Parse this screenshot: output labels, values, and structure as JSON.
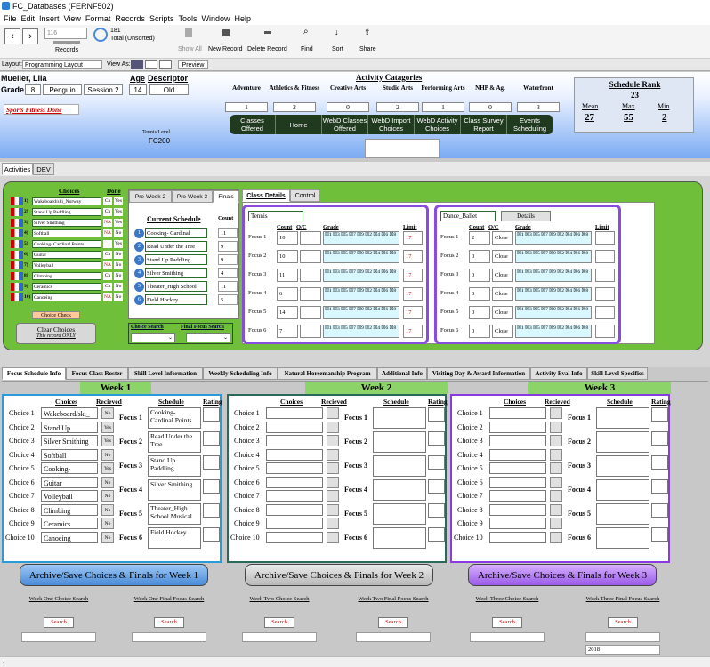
{
  "window": {
    "title": "FC_Databases (FERNF502)"
  },
  "menu": [
    "File",
    "Edit",
    "Insert",
    "View",
    "Format",
    "Records",
    "Scripts",
    "Tools",
    "Window",
    "Help"
  ],
  "toolbar": {
    "record_value": "116",
    "total": "181",
    "total_label": "Total (Unsorted)",
    "records_label": "Records",
    "show_all": "Show All",
    "new_record": "New Record",
    "delete_record": "Delete Record",
    "find": "Find",
    "sort": "Sort",
    "share": "Share"
  },
  "layoutbar": {
    "layout_label": "Layout:",
    "layout_value": "Programming Layout",
    "view_as": "View As:",
    "preview": "Preview"
  },
  "student": {
    "name": "Mueller, Lila",
    "grade_label": "Grade",
    "grade": "8",
    "group": "Penguin",
    "session": "Session 2",
    "age_label": "Age",
    "age": "14",
    "descriptor_label": "Descriptor",
    "descriptor": "Old",
    "alert": "Sports Fitness Done",
    "tennis_level_label": "Tennis Level",
    "tennis_level": "FC200"
  },
  "categories": {
    "title": "Activity Catagories",
    "items": [
      {
        "label": "Adventure",
        "value": "1"
      },
      {
        "label": "Athletics & Fitness",
        "value": "2"
      },
      {
        "label": "Creative Arts",
        "value": "0"
      },
      {
        "label": "Studio Arts",
        "value": "2"
      },
      {
        "label": "Performing Arts",
        "value": "1"
      },
      {
        "label": "NHP & Ag.",
        "value": "0"
      },
      {
        "label": "Waterfront",
        "value": "3"
      }
    ]
  },
  "nav_buttons": [
    "Classes Offered",
    "Home",
    "WebD Classes Offered",
    "WebD Import Choices",
    "WebD Activity Choices",
    "Class Survey Report",
    "Events Scheduling"
  ],
  "schedule_rank": {
    "title": "Schedule Rank",
    "value": "23",
    "mean_label": "Mean",
    "mean": "27",
    "max_label": "Max",
    "max": "55",
    "min_label": "Min",
    "min": "2"
  },
  "main_tabs": [
    "Activities",
    "DEV"
  ],
  "choices_panel": {
    "choices_header": "Choices",
    "done_header": "Done",
    "items": [
      {
        "n": "1)",
        "name": "Wakeboard/ski_Norway",
        "a": "Ch",
        "b": "Yes"
      },
      {
        "n": "2)",
        "name": "Stand Up Paddling",
        "a": "Ch",
        "b": "Yes"
      },
      {
        "n": "3)",
        "name": "Silver Smithing",
        "a": "NA",
        "b": "Yes"
      },
      {
        "n": "4)",
        "name": "Softball",
        "a": "NA",
        "b": "No"
      },
      {
        "n": "5)",
        "name": "Cooking- Cardinal Points",
        "a": "",
        "b": "Yes"
      },
      {
        "n": "6)",
        "name": "Guitar",
        "a": "Ch",
        "b": "No"
      },
      {
        "n": "7)",
        "name": "Volleyball",
        "a": "NA",
        "b": "No"
      },
      {
        "n": "8)",
        "name": "Climbing",
        "a": "Ch",
        "b": "No"
      },
      {
        "n": "9)",
        "name": "Ceramics",
        "a": "Ch",
        "b": "No"
      },
      {
        "n": "10)",
        "name": "Canoeing",
        "a": "NA",
        "b": "No"
      }
    ],
    "choice_check": "Choice Check",
    "clear_choices": "Clear Choices",
    "this_record_only": "This record ONLY"
  },
  "week_tabs": [
    "Pre-Week 2",
    "Pre-Week 3",
    "Finals"
  ],
  "current_schedule": {
    "title": "Current Schedule",
    "count_label": "Count",
    "items": [
      {
        "n": "1",
        "name": "Cooking- Cardinal",
        "count": "11"
      },
      {
        "n": "2",
        "name": "Read Under the Tree",
        "count": "9"
      },
      {
        "n": "3",
        "name": "Stand Up Paddling",
        "count": "9"
      },
      {
        "n": "4",
        "name": "Silver Smithing",
        "count": "4"
      },
      {
        "n": "5",
        "name": "Theater_High School",
        "count": "11"
      },
      {
        "n": "6",
        "name": "Field Hockey",
        "count": "5"
      }
    ]
  },
  "search_labels": {
    "choice": "Choice Search",
    "final": "Final Focus Search"
  },
  "class_tabs": [
    "Class Details",
    "Control"
  ],
  "class_left": {
    "name": "Tennis",
    "count_h": "Count",
    "oc_h": "O/C",
    "grade_h": "Grade",
    "limit_h": "Limit",
    "rows": [
      {
        "label": "Focus 1",
        "count": "10",
        "limit": "17"
      },
      {
        "label": "Focus 2",
        "count": "10",
        "limit": "17"
      },
      {
        "label": "Focus 3",
        "count": "11",
        "limit": "17"
      },
      {
        "label": "Focus 4",
        "count": "6",
        "limit": "17"
      },
      {
        "label": "Focus 5",
        "count": "14",
        "limit": "17"
      },
      {
        "label": "Focus 6",
        "count": "7",
        "limit": "17"
      }
    ]
  },
  "class_right": {
    "name": "Dance_Ballet",
    "details": "Details",
    "count_h": "Count",
    "oc_h": "O/C",
    "grade_h": "Grade",
    "limit_h": "Limit",
    "rows": [
      {
        "label": "Focus 1",
        "count": "2",
        "oc": "Close"
      },
      {
        "label": "Focus 2",
        "count": "0",
        "oc": "Close"
      },
      {
        "label": "Focus 3",
        "count": "0",
        "oc": "Close"
      },
      {
        "label": "Focus 4",
        "count": "0",
        "oc": "Close"
      },
      {
        "label": "Focus 5",
        "count": "0",
        "oc": "Close"
      },
      {
        "label": "Focus 6",
        "count": "0",
        "oc": "Close"
      }
    ]
  },
  "grade_glyphs": "☒1 ☒3 ☒5 ☒7 ☒9 ☒2 ☒4 ☒6 ☒8",
  "bottom_tabs": [
    "Focus Schedule Info",
    "Focus Class Roster",
    "Skill Level Information",
    "Weekly Scheduling Info",
    "Natural Horsemanship Program",
    "Additional Info",
    "Visiting Day & Award Information",
    "Activity Eval Info",
    "Skill Level Specifics"
  ],
  "weeks": [
    {
      "title": "Week 1",
      "color": "#2a9ad8",
      "choices_h": "Choices",
      "recieved_h": "Recieved",
      "schedule_h": "Schedule",
      "rating_h": "Rating",
      "choices": [
        {
          "label": "Choice 1",
          "val": "Wakeboard/ski_",
          "rec": "No"
        },
        {
          "label": "Choice 2",
          "val": "Stand Up",
          "rec": "Yes"
        },
        {
          "label": "Choice 3",
          "val": "Silver Smithing",
          "rec": "Yes"
        },
        {
          "label": "Choice 4",
          "val": "Softball",
          "rec": "No"
        },
        {
          "label": "Choice 5",
          "val": "Cooking-",
          "rec": "Yes"
        },
        {
          "label": "Choice 6",
          "val": "Guitar",
          "rec": "No"
        },
        {
          "label": "Choice 7",
          "val": "Volleyball",
          "rec": "No"
        },
        {
          "label": "Choice 8",
          "val": "Climbing",
          "rec": "No"
        },
        {
          "label": "Choice 9",
          "val": "Ceramics",
          "rec": "No"
        },
        {
          "label": "Choice 10",
          "val": "Canoeing",
          "rec": "No"
        }
      ],
      "focus": [
        {
          "label": "Focus 1",
          "val": "Cooking- Cardinal Points"
        },
        {
          "label": "Focus 2",
          "val": "Read Under the Tree"
        },
        {
          "label": "Focus 3",
          "val": "Stand Up Paddling"
        },
        {
          "label": "Focus 4",
          "val": "Silver Smithing"
        },
        {
          "label": "Focus 5",
          "val": "Theater_High School Musical"
        },
        {
          "label": "Focus 6",
          "val": "Field Hockey"
        }
      ],
      "archive": "Archive/Save Choices & Finals for Week 1"
    },
    {
      "title": "Week 2",
      "color": "#2a6a5a",
      "choices_h": "Choices",
      "recieved_h": "Recieved",
      "schedule_h": "Schedule",
      "rating_h": "Rating",
      "choices": [
        {
          "label": "Choice 1",
          "val": "",
          "rec": ""
        },
        {
          "label": "Choice 2",
          "val": "",
          "rec": ""
        },
        {
          "label": "Choice 3",
          "val": "",
          "rec": ""
        },
        {
          "label": "Choice 4",
          "val": "",
          "rec": ""
        },
        {
          "label": "Choice 5",
          "val": "",
          "rec": ""
        },
        {
          "label": "Choice 6",
          "val": "",
          "rec": ""
        },
        {
          "label": "Choice 7",
          "val": "",
          "rec": ""
        },
        {
          "label": "Choice 8",
          "val": "",
          "rec": ""
        },
        {
          "label": "Choice 9",
          "val": "",
          "rec": ""
        },
        {
          "label": "Choice 10",
          "val": "",
          "rec": ""
        }
      ],
      "focus": [
        {
          "label": "Focus 1",
          "val": ""
        },
        {
          "label": "Focus 2",
          "val": ""
        },
        {
          "label": "Focus 3",
          "val": ""
        },
        {
          "label": "Focus 4",
          "val": ""
        },
        {
          "label": "Focus 5",
          "val": ""
        },
        {
          "label": "Focus 6",
          "val": ""
        }
      ],
      "archive": "Archive/Save Choices & Finals for Week 2"
    },
    {
      "title": "Week 3",
      "color": "#8a3be0",
      "choices_h": "Choices",
      "recieved_h": "Recieved",
      "schedule_h": "Schedule",
      "rating_h": "Rating",
      "choices": [
        {
          "label": "Choice 1",
          "val": "",
          "rec": ""
        },
        {
          "label": "Choice 2",
          "val": "",
          "rec": ""
        },
        {
          "label": "Choice 3",
          "val": "",
          "rec": ""
        },
        {
          "label": "Choice 4",
          "val": "",
          "rec": ""
        },
        {
          "label": "Choice 5",
          "val": "",
          "rec": ""
        },
        {
          "label": "Choice 6",
          "val": "",
          "rec": ""
        },
        {
          "label": "Choice 7",
          "val": "",
          "rec": ""
        },
        {
          "label": "Choice 8",
          "val": "",
          "rec": ""
        },
        {
          "label": "Choice 9",
          "val": "",
          "rec": ""
        },
        {
          "label": "Choice 10",
          "val": "",
          "rec": ""
        }
      ],
      "focus": [
        {
          "label": "Focus 1",
          "val": ""
        },
        {
          "label": "Focus 2",
          "val": ""
        },
        {
          "label": "Focus 3",
          "val": ""
        },
        {
          "label": "Focus 4",
          "val": ""
        },
        {
          "label": "Focus 5",
          "val": ""
        },
        {
          "label": "Focus 6",
          "val": ""
        }
      ],
      "archive": "Archive/Save Choices & Finals for Week 3"
    }
  ],
  "search_blocks": [
    {
      "title": "Week One Choice Search",
      "btn": "Search",
      "year": ""
    },
    {
      "title": "Week One Final Focus Search",
      "btn": "Search",
      "year": ""
    },
    {
      "title": "Week Two Choice Search",
      "btn": "Search",
      "year": ""
    },
    {
      "title": "Week Two Final Focus Search",
      "btn": "Search",
      "year": ""
    },
    {
      "title": "Week Three Choice Search",
      "btn": "Search",
      "year": ""
    },
    {
      "title": "Week Three Final Focus Search",
      "btn": "Search",
      "year": "2018"
    }
  ],
  "colors": {
    "green_panel": "#6fbf3a",
    "purple": "#8a4be0",
    "week_header": "#8cd36a",
    "nav_button": "#1f3a1f"
  }
}
